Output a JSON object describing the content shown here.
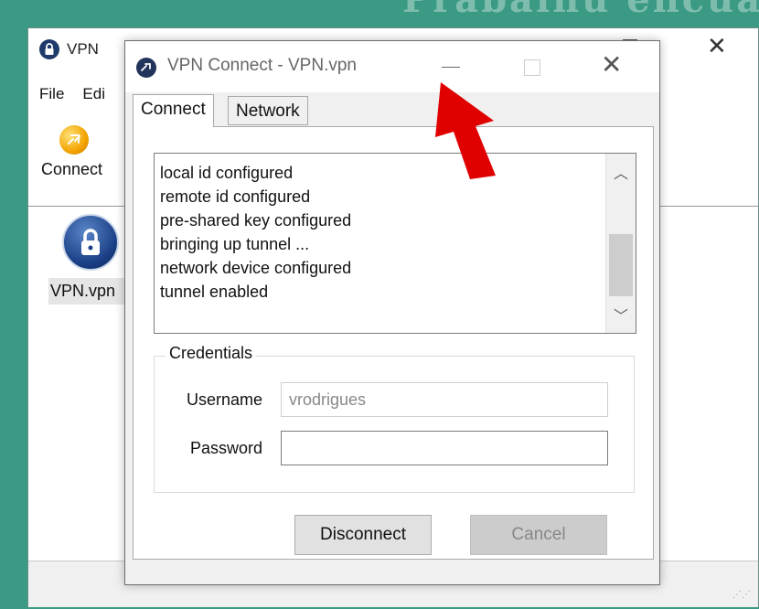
{
  "background": {
    "watermark_text": "Prabainu encuaerve"
  },
  "main_window": {
    "title": "VPN",
    "menu": [
      "File",
      "Edi"
    ],
    "toolbar": {
      "connect_label": "Connect"
    },
    "profile_label": "VPN.vpn"
  },
  "dialog": {
    "title": "VPN Connect - VPN.vpn",
    "tabs": [
      {
        "label": "Connect",
        "active": true
      },
      {
        "label": "Network",
        "active": false
      }
    ],
    "log": [
      "local id configured",
      "remote id configured",
      "pre-shared key configured",
      "bringing up tunnel ...",
      "network device configured",
      "tunnel enabled"
    ],
    "credentials": {
      "legend": "Credentials",
      "username_label": "Username",
      "username_value": "vrodrigues",
      "password_label": "Password",
      "password_value": ""
    },
    "buttons": {
      "disconnect": "Disconnect",
      "cancel": "Cancel"
    }
  },
  "colors": {
    "desktop": "#3a9a83",
    "annotation_arrow": "#e00000",
    "connect_orb": "#f4a300",
    "lock_icon": "#1b3f86"
  },
  "icons": {
    "main_window": "lock-icon",
    "dialog": "globe-icon",
    "toolbar_connect": "connect-orb-icon",
    "profile": "lock-icon",
    "annotation": "red-arrow-icon"
  }
}
